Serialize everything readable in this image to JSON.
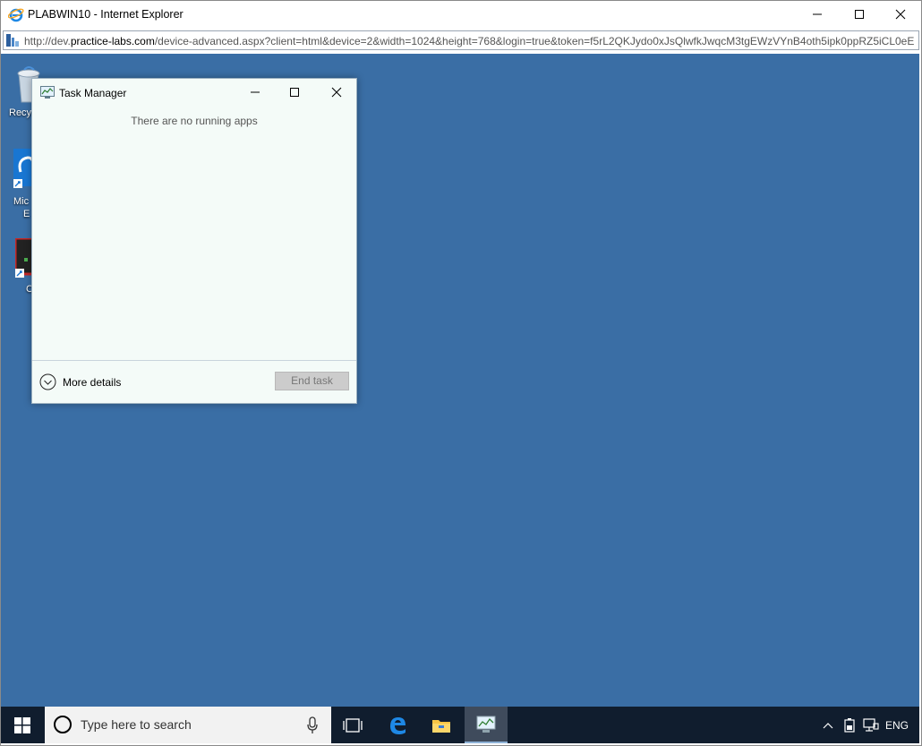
{
  "window": {
    "title": "PLABWIN10 - Internet Explorer",
    "url_prefix": "http://dev.",
    "url_domain": "practice-labs.com",
    "url_rest": "/device-advanced.aspx?client=html&device=2&width=1024&height=768&login=true&token=f5rL2QKJydo0xJsQlwfkJwqcM3tgEWzVYnB4oth5ipk0ppRZ5iCL0eE"
  },
  "desktop": {
    "icons": [
      {
        "name": "recycle-bin",
        "label": "Recyc"
      },
      {
        "name": "edge-shortcut",
        "label_line1": "Mic",
        "label_line2": "E"
      },
      {
        "name": "app-shortcut",
        "label": "C"
      }
    ],
    "background": "#3a6ea5"
  },
  "task_manager": {
    "title": "Task Manager",
    "empty_message": "There are no running apps",
    "more_details": "More details",
    "end_task": "End task"
  },
  "taskbar": {
    "search_placeholder": "Type here to search",
    "language": "ENG"
  },
  "colors": {
    "taskbar": "#101d2e",
    "desktop": "#3a6ea5",
    "task_manager_bg": "#f4fbf8"
  }
}
